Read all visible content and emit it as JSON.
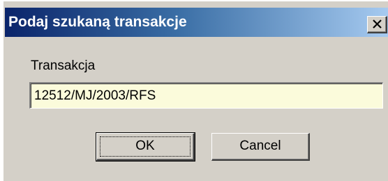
{
  "dialog": {
    "title": "Podaj szukaną transakcje",
    "close_icon": "close-icon",
    "field_label": "Transakcja",
    "field_value": "12512/MJ/2003/RFS",
    "ok_label": "OK",
    "cancel_label": "Cancel"
  },
  "colors": {
    "titlebar_start": "#0a246a",
    "titlebar_end": "#a6caf0",
    "face": "#d4d0c8",
    "field_bg": "#fbfbdb"
  }
}
